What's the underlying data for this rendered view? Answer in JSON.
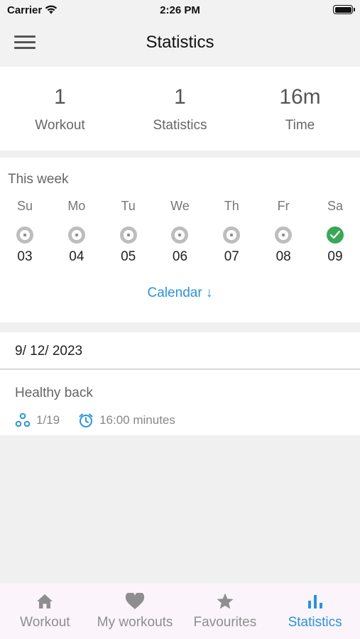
{
  "status_bar": {
    "carrier": "Carrier",
    "time": "2:26 PM"
  },
  "nav": {
    "title": "Statistics"
  },
  "summary": [
    {
      "value": "1",
      "label": "Workout"
    },
    {
      "value": "1",
      "label": "Statistics"
    },
    {
      "value": "16m",
      "label": "Time"
    }
  ],
  "week": {
    "title": "This week",
    "days": [
      {
        "name": "Su",
        "date": "03",
        "done": false
      },
      {
        "name": "Mo",
        "date": "04",
        "done": false
      },
      {
        "name": "Tu",
        "date": "05",
        "done": false
      },
      {
        "name": "We",
        "date": "06",
        "done": false
      },
      {
        "name": "Th",
        "date": "07",
        "done": false
      },
      {
        "name": "Fr",
        "date": "08",
        "done": false
      },
      {
        "name": "Sa",
        "date": "09",
        "done": true
      }
    ],
    "calendar_link": "Calendar ↓"
  },
  "history": {
    "date": "9/ 12/ 2023",
    "entry": {
      "title": "Healthy back",
      "exercises": "1/19",
      "duration": "16:00 minutes"
    }
  },
  "tabs": [
    {
      "label": "Workout",
      "icon": "home-icon",
      "active": false
    },
    {
      "label": "My workouts",
      "icon": "heart-icon",
      "active": false
    },
    {
      "label": "Favourites",
      "icon": "star-icon",
      "active": false
    },
    {
      "label": "Statistics",
      "icon": "bar-chart-icon",
      "active": true
    }
  ],
  "colors": {
    "accent": "#2a93d8",
    "done": "#3aa757",
    "inactive_tab": "#8e8e8e"
  }
}
